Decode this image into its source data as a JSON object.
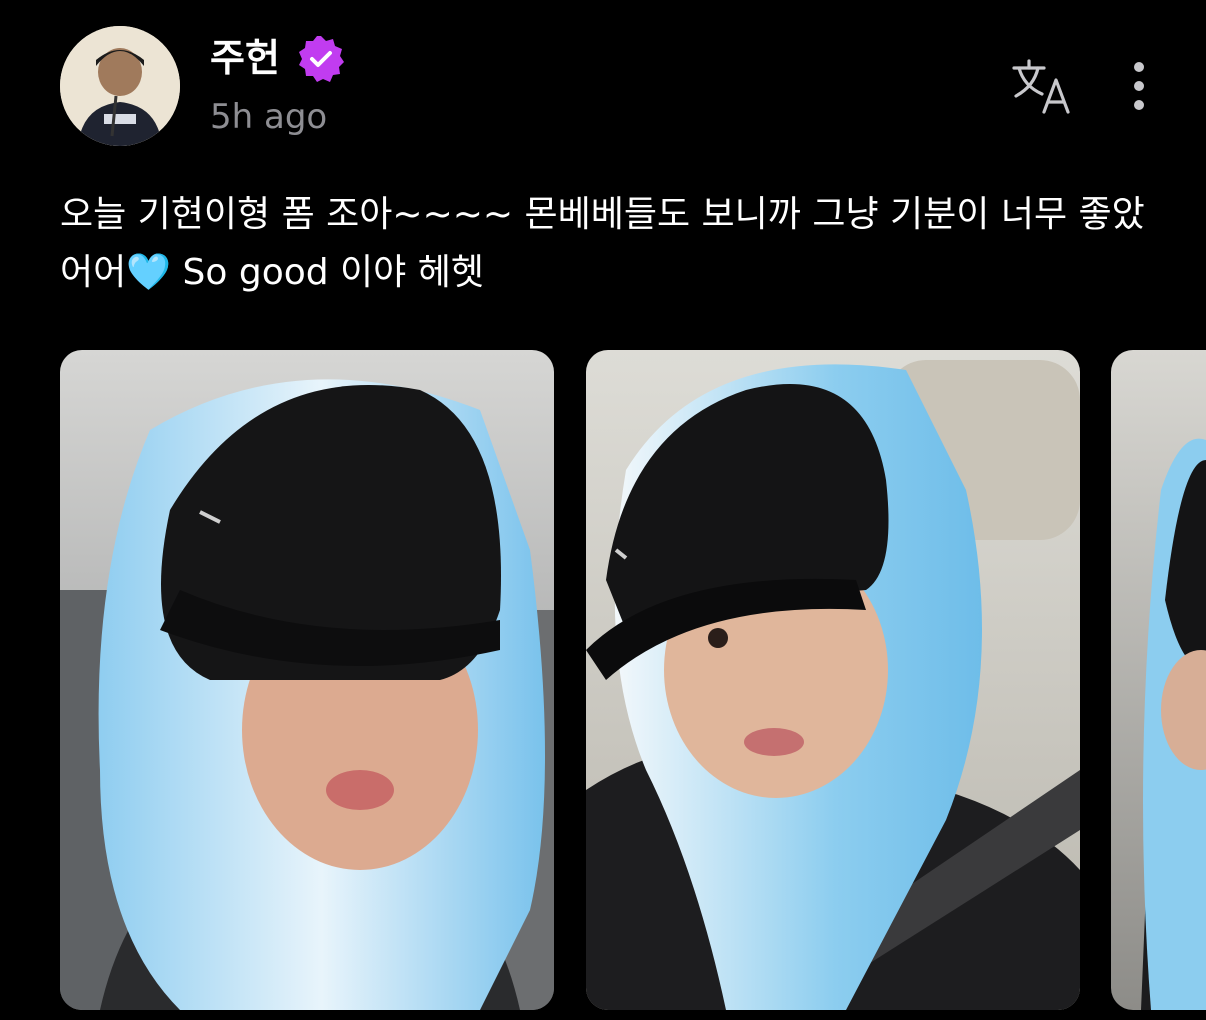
{
  "author": {
    "name": "주헌",
    "verified": true,
    "verified_color": "#c13cf0",
    "avatar_icon": "avatar"
  },
  "post": {
    "timestamp": "5h ago",
    "text_before_emoji": "오늘 기현이형 폼 조아~~~~ 몬베베들도 보니까 그냥 기분이 너무 좋았어어",
    "emoji": "🩵",
    "text_after_emoji": " So good 이야 헤헷"
  },
  "actions": {
    "translate_icon": "translate-icon",
    "more_icon": "more-vertical-icon"
  },
  "media": {
    "count_visible": 3,
    "items": [
      {
        "kind": "photo"
      },
      {
        "kind": "photo"
      },
      {
        "kind": "photo"
      }
    ]
  },
  "colors": {
    "background": "#000000",
    "text": "#ffffff",
    "muted": "#8e8e93",
    "accent_blue": "#7cd0f5"
  }
}
